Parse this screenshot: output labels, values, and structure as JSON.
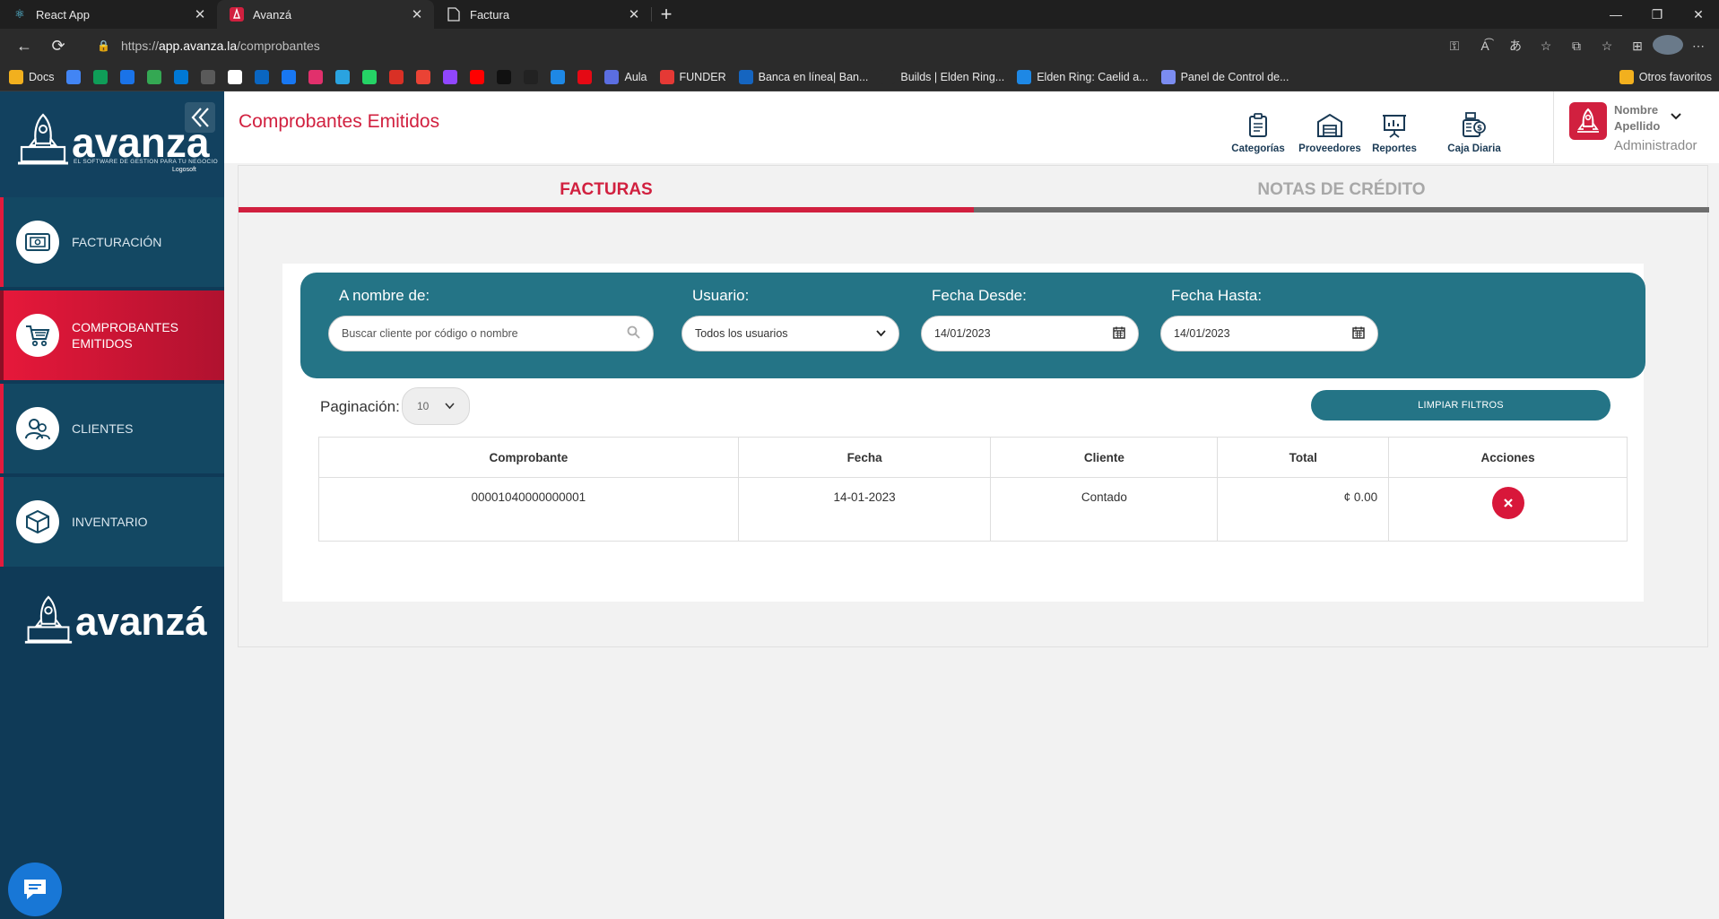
{
  "browser": {
    "tabs": [
      {
        "title": "React App",
        "icon": "react-icon"
      },
      {
        "title": "Avanzá",
        "icon": "avanza-icon"
      },
      {
        "title": "Factura",
        "icon": "page-icon"
      }
    ],
    "url_scheme": "https://",
    "url_host": "app.avanza.la",
    "url_path": "/comprobantes",
    "bookmarks": [
      {
        "label": "Docs",
        "color": "#f2b01e"
      },
      {
        "label": "",
        "color": "#4285f4"
      },
      {
        "label": "",
        "color": "#0f9d58"
      },
      {
        "label": "",
        "color": "#1a73e8"
      },
      {
        "label": "",
        "color": "#34a853"
      },
      {
        "label": "",
        "color": "#0078d4"
      },
      {
        "label": "",
        "color": "#5a5a5a"
      },
      {
        "label": "",
        "color": "#ffffff"
      },
      {
        "label": "",
        "color": "#0a66c2"
      },
      {
        "label": "",
        "color": "#1877f2"
      },
      {
        "label": "",
        "color": "#e1306c"
      },
      {
        "label": "",
        "color": "#2aa3e0"
      },
      {
        "label": "",
        "color": "#25d366"
      },
      {
        "label": "",
        "color": "#d93025"
      },
      {
        "label": "",
        "color": "#ea4335"
      },
      {
        "label": "",
        "color": "#9146ff"
      },
      {
        "label": "",
        "color": "#ff0000"
      },
      {
        "label": "",
        "color": "#111111"
      },
      {
        "label": "",
        "color": "#222222"
      },
      {
        "label": "",
        "color": "#1e88e5"
      },
      {
        "label": "",
        "color": "#e50914"
      },
      {
        "label": "Aula",
        "color": "#5b6ee1"
      },
      {
        "label": "FUNDER",
        "color": "#e53935"
      },
      {
        "label": "Banca en línea| Ban...",
        "color": "#1565c0"
      },
      {
        "label": "Builds | Elden Ring...",
        "color": "#2b2b2b"
      },
      {
        "label": "Elden Ring: Caelid a...",
        "color": "#1e88e5"
      },
      {
        "label": "Panel de Control de...",
        "color": "#7b8cf0"
      }
    ],
    "other_favorites": "Otros favoritos"
  },
  "sidebar": {
    "logo_text": "avanza",
    "logo_tagline": "EL SOFTWARE DE GESTION PARA TU NEGOCIO",
    "logo_brand": "Logosoft",
    "items": [
      {
        "label": "FACTURACIÓN",
        "icon": "invoice-icon",
        "active": false
      },
      {
        "label": "COMPROBANTES EMITIDOS",
        "icon": "cart-icon",
        "active": true
      },
      {
        "label": "CLIENTES",
        "icon": "users-icon",
        "active": false
      },
      {
        "label": "INVENTARIO",
        "icon": "box-icon",
        "active": false
      }
    ],
    "bottom_logo_text": "avanzá"
  },
  "header": {
    "title": "Comprobantes Emitidos",
    "buttons": [
      {
        "label": "Categorías",
        "icon": "clipboard-icon"
      },
      {
        "label": "Proveedores",
        "icon": "warehouse-icon"
      },
      {
        "label": "Reportes",
        "icon": "presentation-chart-icon"
      },
      {
        "label": "Caja Diaria",
        "icon": "cash-register-icon"
      }
    ],
    "user": {
      "name": "Nombre Apellido",
      "role": "Administrador"
    }
  },
  "content": {
    "tabs": [
      {
        "label": "FACTURAS",
        "active": true
      },
      {
        "label": "NOTAS DE CRÉDITO",
        "active": false
      }
    ],
    "filters": {
      "client_label": "A nombre de:",
      "client_placeholder": "Buscar cliente por código o nombre",
      "user_label": "Usuario:",
      "user_value": "Todos los usuarios",
      "from_label": "Fecha Desde:",
      "from_value": "14/01/2023",
      "to_label": "Fecha Hasta:",
      "to_value": "14/01/2023"
    },
    "pagination_label": "Paginación:",
    "pagination_value": "10",
    "clear_filters": "LIMPIAR FILTROS",
    "table": {
      "headers": [
        "Comprobante",
        "Fecha",
        "Cliente",
        "Total",
        "Acciones"
      ],
      "rows": [
        {
          "comprobante": "00001040000000001",
          "fecha": "14-01-2023",
          "cliente": "Contado",
          "total": "¢ 0.00"
        }
      ]
    }
  },
  "colors": {
    "accent_red": "#d1203f",
    "teal": "#247486",
    "sidebar_navy": "#0f3a57"
  }
}
